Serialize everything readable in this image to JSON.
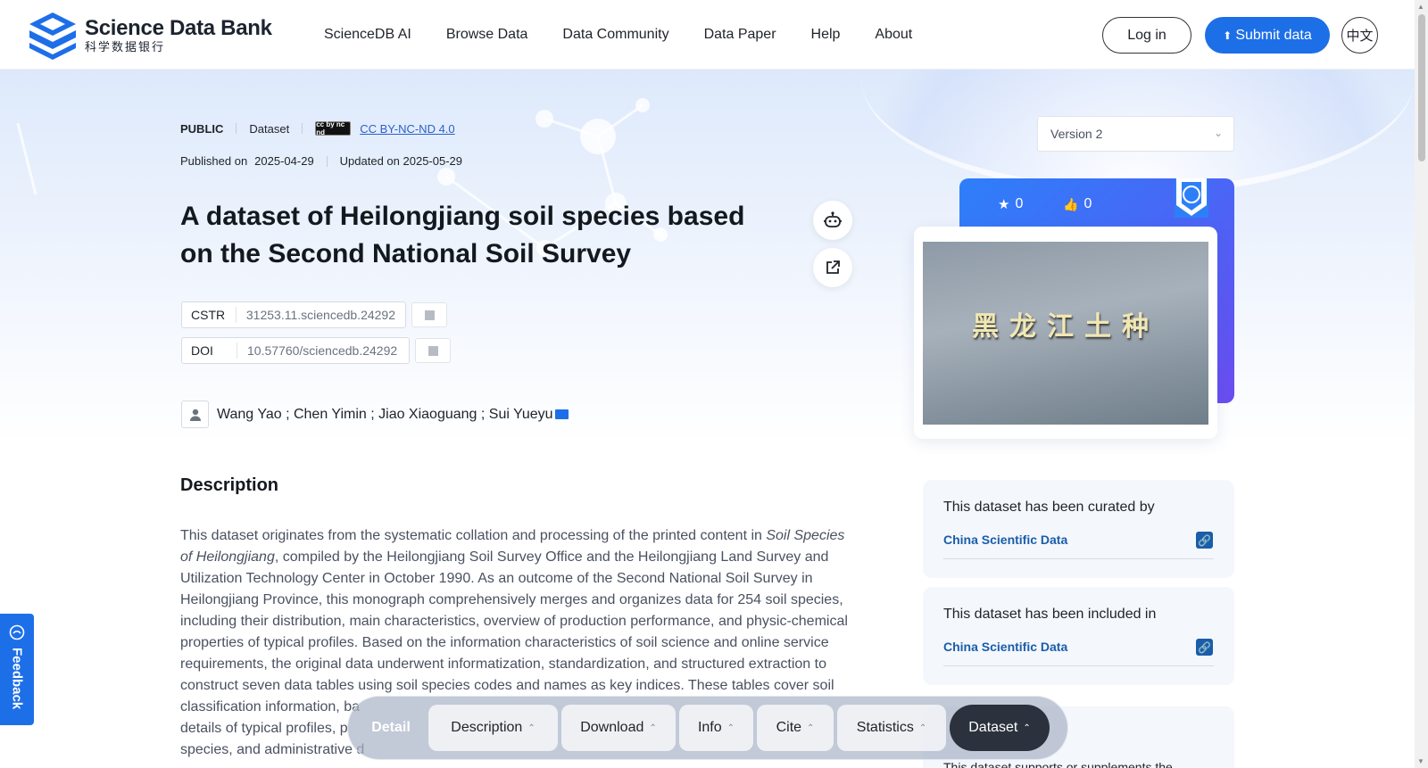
{
  "header": {
    "logo_en": "Science Data Bank",
    "logo_cn": "科学数据银行",
    "nav": [
      "ScienceDB AI",
      "Browse Data",
      "Data Community",
      "Data Paper",
      "Help",
      "About"
    ],
    "login_label": "Log in",
    "submit_label": "Submit data",
    "lang_label": "中文"
  },
  "meta": {
    "visibility": "PUBLIC",
    "type": "Dataset",
    "license_badge": "cc by nc nd",
    "license": "CC BY-NC-ND 4.0",
    "published_label": "Published on",
    "published_date": "2025-04-29",
    "updated_label": "Updated on 2025-05-29"
  },
  "dataset": {
    "title": "A dataset of Heilongjiang soil species based on the Second National Soil Survey",
    "cstr_label": "CSTR",
    "cstr_value": "31253.11.sciencedb.24292",
    "doi_label": "DOI",
    "doi_value": "10.57760/sciencedb.24292",
    "authors": "Wang Yao ; Chen Yimin ; Jiao Xiaoguang ; Sui Yueyu"
  },
  "description": {
    "heading": "Description",
    "text_part1": "This dataset originates from the systematic collation and processing of the printed content in ",
    "text_italic": "Soil Species of Heilongjiang",
    "text_part2": ", compiled by the Heilongjiang Soil Survey Office and the Heilongjiang Land Survey and Utilization Technology Center in October 1990. As an outcome of the Second National Soil Survey in Heilongjiang Province, this monograph comprehensively merges and organizes data for 254 soil species, including their distribution, main characteristics, overview of production performance, and physic-chemical properties of typical profiles. Based on the information characteristics of soil science and online service requirements, the original data underwent informatization, standardization, and structured extraction to construct seven data tables using soil species codes and names as key indices. These tables cover soil classification information, ba",
    "text_line2": "details of typical profiles, p",
    "text_line3": "species, and administrative d"
  },
  "sidebar": {
    "version": "Version 2",
    "stars": "0",
    "likes": "0",
    "image_caption": "黑龙江土种",
    "curated_title": "This dataset has been curated by",
    "curated_link": "China Scientific Data",
    "included_title": "This dataset has been included in",
    "included_link": "China Scientific Data",
    "supports_title": "This dataset supports or supplements the"
  },
  "feedback_label": "Feedback",
  "tabbar": {
    "detail": "Detail",
    "tabs": [
      "Description",
      "Download",
      "Info",
      "Cite",
      "Statistics"
    ],
    "active": "Dataset"
  },
  "colors": {
    "accent": "#1d6fe8",
    "link": "#1a5daa",
    "active_tab": "#2b323d"
  }
}
